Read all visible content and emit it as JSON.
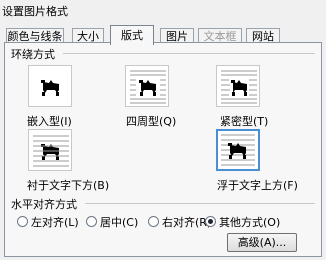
{
  "window": {
    "title": "设置图片格式"
  },
  "tabs": [
    {
      "label": "颜色与线条",
      "active": false,
      "disabled": false
    },
    {
      "label": "大小",
      "active": false,
      "disabled": false
    },
    {
      "label": "版式",
      "active": true,
      "disabled": false
    },
    {
      "label": "图片",
      "active": false,
      "disabled": false
    },
    {
      "label": "文本框",
      "active": false,
      "disabled": true
    },
    {
      "label": "网站",
      "active": false,
      "disabled": false
    }
  ],
  "wrap_section": {
    "title": "环绕方式",
    "options": [
      {
        "label": "嵌入型(I)",
        "icon": "inline-wrap-icon",
        "selected": false
      },
      {
        "label": "四周型(Q)",
        "icon": "square-wrap-icon",
        "selected": false
      },
      {
        "label": "紧密型(T)",
        "icon": "tight-wrap-icon",
        "selected": false
      },
      {
        "label": "衬于文字下方(B)",
        "icon": "behind-text-icon",
        "selected": false
      },
      {
        "label": "浮于文字上方(F)",
        "icon": "in-front-of-text-icon",
        "selected": true
      }
    ]
  },
  "align_section": {
    "title": "水平对齐方式",
    "options": [
      {
        "label": "左对齐(L)",
        "checked": false
      },
      {
        "label": "居中(C)",
        "checked": false
      },
      {
        "label": "右对齐(R)",
        "checked": false
      },
      {
        "label": "其他方式(O)",
        "checked": true
      }
    ]
  },
  "advanced_button": {
    "label": "高级(A)..."
  },
  "colors": {
    "selection_border": "#4a8fd6",
    "icon_fill": "#000000"
  }
}
